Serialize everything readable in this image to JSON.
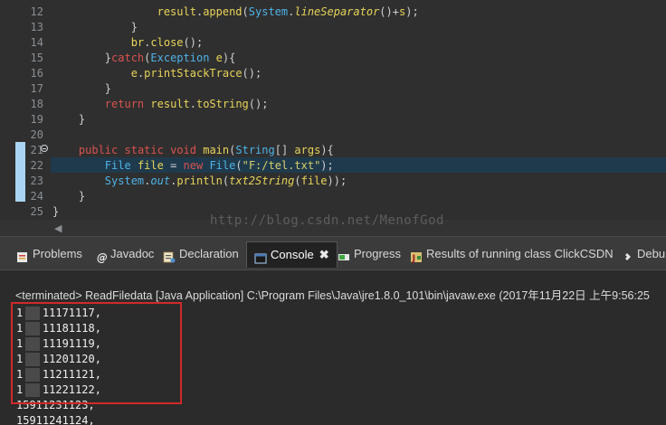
{
  "editor": {
    "line_numbers": [
      "12",
      "13",
      "14",
      "15",
      "16",
      "17",
      "18",
      "19",
      "20",
      "21",
      "22",
      "23",
      "24",
      "25"
    ],
    "watermark": "http://blog.csdn.net/MenofGod"
  },
  "views": {
    "tabs": [
      {
        "label": "Problems",
        "icon": "problems-icon"
      },
      {
        "label": "Javadoc",
        "icon": "javadoc-icon"
      },
      {
        "label": "Declaration",
        "icon": "declaration-icon"
      },
      {
        "label": "Console",
        "icon": "console-icon",
        "active": true
      },
      {
        "label": "Progress",
        "icon": "progress-icon"
      },
      {
        "label": "Results of running class ClickCSDN",
        "icon": "junit-icon"
      },
      {
        "label": "Debu",
        "icon": "debug-icon"
      }
    ],
    "close_symbol": "✖"
  },
  "console": {
    "header": "<terminated> ReadFiledata [Java Application] C:\\Program Files\\Java\\jre1.8.0_101\\bin\\javaw.exe (2017年11月22日 上午9:56:25",
    "lines": [
      "1   11171117,",
      "1   11181118,",
      "1   11191119,",
      "1   11201120,",
      "1   11211121,",
      "1   11221122,",
      "15911231123,",
      "15911241124,"
    ]
  },
  "colors": {
    "editor_bg": "#2f2f2f",
    "current_line": "#1f3a4c",
    "keyword": "#d9534f",
    "type": "#4fb3e8",
    "highlight_box": "#d02a2a"
  }
}
